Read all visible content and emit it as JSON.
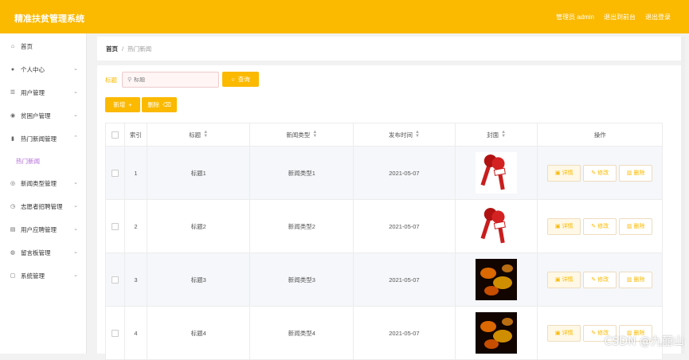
{
  "app": {
    "title": "精准扶贫管理系统"
  },
  "topbar": {
    "admin_label": "管理员 admin",
    "back_label": "退出到前台",
    "logout_label": "退出登录"
  },
  "sidebar": {
    "items": [
      {
        "label": "首页",
        "icon": "home-icon",
        "chev": ""
      },
      {
        "label": "个人中心",
        "icon": "user-icon",
        "chev": "⌄"
      },
      {
        "label": "用户管理",
        "icon": "list-icon",
        "chev": "⌄"
      },
      {
        "label": "贫困户管理",
        "icon": "location-icon",
        "chev": "⌄"
      },
      {
        "label": "热门新闻管理",
        "icon": "chart-icon",
        "chev": "⌃"
      },
      {
        "label": "新闻类型管理",
        "icon": "compass-icon",
        "chev": "⌄"
      },
      {
        "label": "志愿者招聘管理",
        "icon": "clock-icon",
        "chev": "⌄"
      },
      {
        "label": "用户应聘管理",
        "icon": "file-icon",
        "chev": "⌄"
      },
      {
        "label": "留言板管理",
        "icon": "globe-icon",
        "chev": "⌄"
      },
      {
        "label": "系统管理",
        "icon": "chat-icon",
        "chev": "⌄"
      }
    ],
    "sub_item": "热门新闻"
  },
  "breadcrumb": {
    "home": "首页",
    "sep": "/",
    "current": "热门新闻"
  },
  "search": {
    "label": "标题",
    "placeholder": "标题",
    "query_label": "查询"
  },
  "toolbar": {
    "add_label": "新增",
    "delete_label": "删除"
  },
  "table": {
    "headers": {
      "index": "索引",
      "title": "标题",
      "type": "新闻类型",
      "date": "发布时间",
      "cover": "封面",
      "ops": "操作"
    },
    "rows": [
      {
        "index": "1",
        "title": "标题1",
        "type": "新闻类型1",
        "date": "2021-05-07",
        "cover": "microphone"
      },
      {
        "index": "2",
        "title": "标题2",
        "type": "新闻类型2",
        "date": "2021-05-07",
        "cover": "microphone"
      },
      {
        "index": "3",
        "title": "标题3",
        "type": "新闻类型3",
        "date": "2021-05-07",
        "cover": "fire-letters"
      },
      {
        "index": "4",
        "title": "标题4",
        "type": "新闻类型4",
        "date": "2021-05-07",
        "cover": "fire-letters"
      }
    ],
    "actions": {
      "detail": "详情",
      "edit": "修改",
      "delete": "删除"
    }
  },
  "watermark": "CSDN @九囍山",
  "colors": {
    "accent": "#fbb900",
    "sub_active": "#b26ad8"
  }
}
